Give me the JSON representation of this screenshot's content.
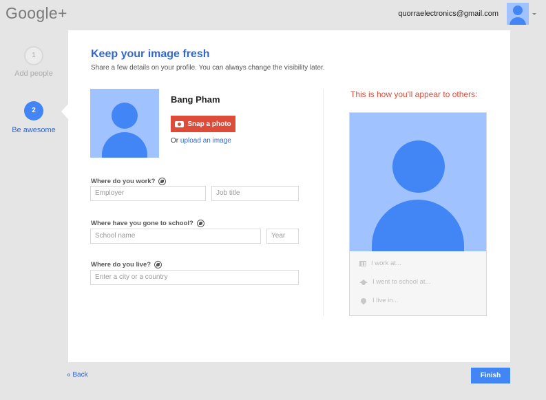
{
  "header": {
    "logo": "Google+",
    "account_email": "quorraelectronics@gmail.com"
  },
  "steps": [
    {
      "number": "1",
      "label": "Add people",
      "active": false
    },
    {
      "number": "2",
      "label": "Be awesome",
      "active": true
    }
  ],
  "main": {
    "title": "Keep your image fresh",
    "subtitle": "Share a few details on your profile. You can always change the visibility later.",
    "profile_name": "Bang Pham",
    "snap_photo_label": "Snap a photo",
    "upload_prefix": "Or",
    "upload_link": "upload an image",
    "work": {
      "label": "Where do you work?",
      "employer_placeholder": "Employer",
      "job_title_placeholder": "Job title"
    },
    "school": {
      "label": "Where have you gone to school?",
      "school_placeholder": "School name",
      "year_placeholder": "Year"
    },
    "live": {
      "label": "Where do you live?",
      "city_placeholder": "Enter a city or a country"
    }
  },
  "preview": {
    "heading": "This is how you'll appear to others:",
    "work_text": "I work at...",
    "school_text": "I went to school at...",
    "live_text": "I live in..."
  },
  "footer": {
    "back_label": "« Back",
    "finish_label": "Finish"
  },
  "colors": {
    "accent_blue": "#4285f4",
    "link_blue": "#3366cc",
    "red": "#dd4b39",
    "avatar_bg": "#a0c3ff"
  },
  "icons": [
    "google-plus-logo",
    "avatar-icon",
    "camera-icon",
    "globe-icon",
    "building-icon",
    "graduation-cap-icon",
    "location-pin-icon"
  ]
}
